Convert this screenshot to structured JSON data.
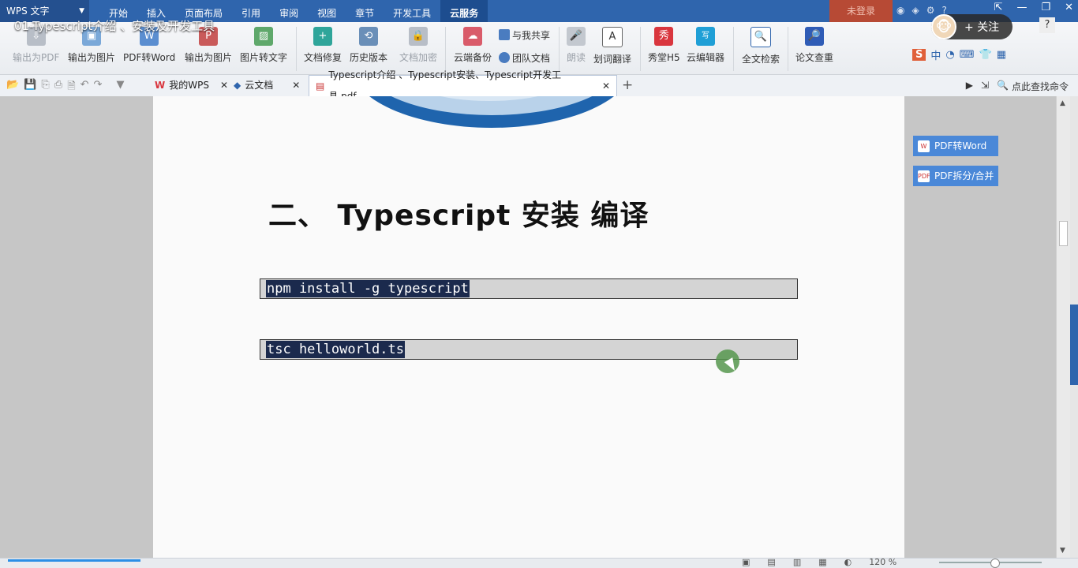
{
  "app": {
    "logo": "WPS 文字",
    "video_title": "01-Typescript介绍 、安装及开发工具"
  },
  "menus": [
    "开始",
    "插入",
    "页面布局",
    "引用",
    "审阅",
    "视图",
    "章节",
    "开发工具",
    "云服务"
  ],
  "active_menu": "云服务",
  "login_label": "未登录",
  "follow_label": "+ 关注",
  "help_label": "?",
  "ribbon": {
    "export_pdf": "输出为PDF",
    "export_image": "输出为图片",
    "pdf_to_word": "PDF转Word",
    "export_image2": "输出为图片",
    "image_to_text": "图片转文字",
    "doc_repair": "文档修复",
    "history": "历史版本",
    "doc_encrypt": "文档加密",
    "cloud_backup": "云端备份",
    "share_with_me": "与我共享",
    "team_docs": "团队文档",
    "read_aloud": "朗读",
    "translate": "划词翻译",
    "xiutang": "秀堂H5",
    "cloud_editor": "云编辑器",
    "fulltext_search": "全文检索",
    "paper_check": "论文查重"
  },
  "tabs": {
    "my_wps": "我的WPS",
    "cloud_doc": "云文档",
    "active_doc": "Typescript介绍 、Typescript安装、Typescript开发工具.pdf",
    "search_cmd": "点此查找命令"
  },
  "document": {
    "heading": "二、 Typescript 安装  编译",
    "code1": "npm install -g typescript",
    "code2": "tsc helloworld.ts"
  },
  "side_panel": {
    "pdf_to_word": "PDF转Word",
    "pdf_split": "PDF拆分/合并"
  },
  "status": {
    "zoom": "120 %"
  }
}
